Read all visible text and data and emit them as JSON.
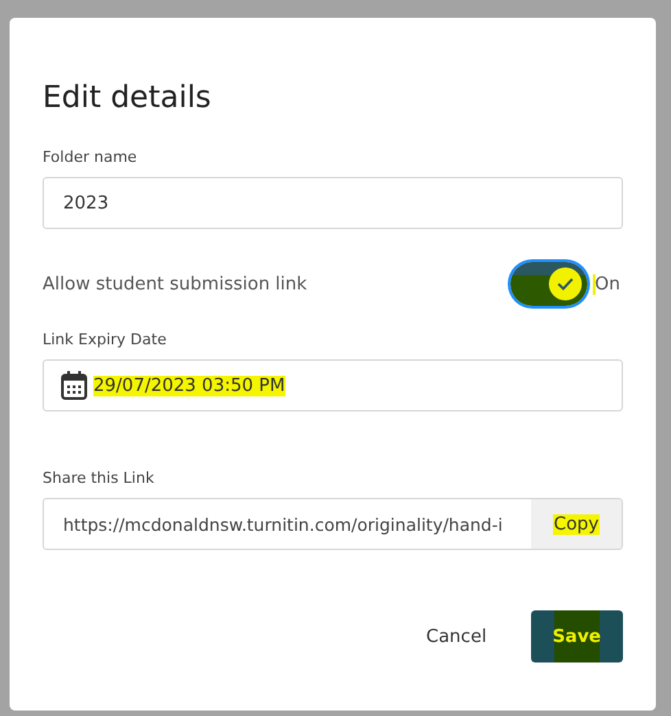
{
  "dialog": {
    "title": "Edit details",
    "folder_name": {
      "label": "Folder name",
      "value": "2023"
    },
    "submission_link": {
      "label": "Allow student submission link",
      "on": true,
      "state_text": "On",
      "highlighted": true
    },
    "expiry": {
      "label": "Link Expiry Date",
      "value": "29/07/2023 03:50 PM",
      "highlighted": true
    },
    "share": {
      "label": "Share this Link",
      "value": "https://mcdonaldnsw.turnitin.com/originality/hand-i",
      "copy_button": "Copy",
      "copy_highlighted": true
    },
    "buttons": [
      {
        "kind": "text",
        "label": "Cancel"
      },
      {
        "kind": "primary",
        "label": "Save",
        "highlighted": true
      }
    ]
  }
}
